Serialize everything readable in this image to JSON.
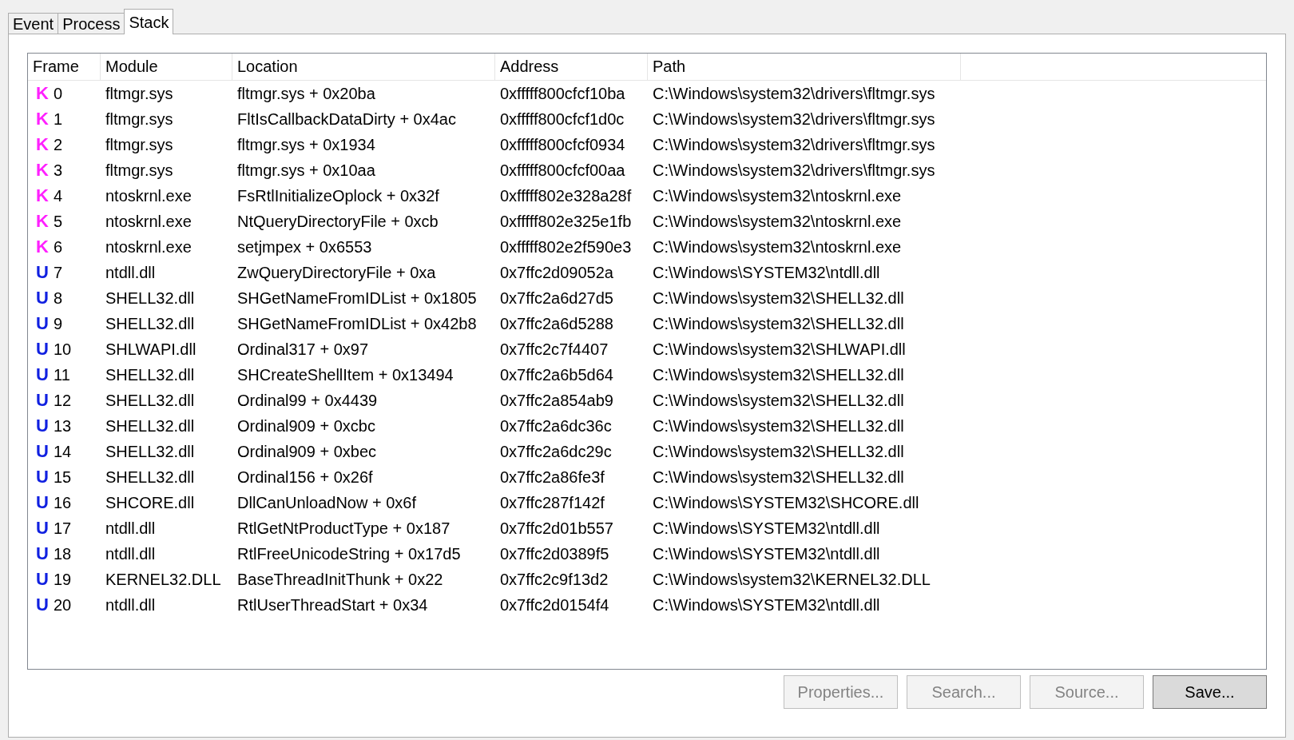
{
  "tabs": [
    {
      "label": "Event",
      "selected": false
    },
    {
      "label": "Process",
      "selected": false
    },
    {
      "label": "Stack",
      "selected": true
    }
  ],
  "table": {
    "columns": [
      "Frame",
      "Module",
      "Location",
      "Address",
      "Path"
    ],
    "rows": [
      {
        "kind": "kernel",
        "mark": "K",
        "frame": "0",
        "module": "fltmgr.sys",
        "location": "fltmgr.sys + 0x20ba",
        "address": "0xfffff800cfcf10ba",
        "path": "C:\\Windows\\system32\\drivers\\fltmgr.sys"
      },
      {
        "kind": "kernel",
        "mark": "K",
        "frame": "1",
        "module": "fltmgr.sys",
        "location": "FltIsCallbackDataDirty + 0x4ac",
        "address": "0xfffff800cfcf1d0c",
        "path": "C:\\Windows\\system32\\drivers\\fltmgr.sys"
      },
      {
        "kind": "kernel",
        "mark": "K",
        "frame": "2",
        "module": "fltmgr.sys",
        "location": "fltmgr.sys + 0x1934",
        "address": "0xfffff800cfcf0934",
        "path": "C:\\Windows\\system32\\drivers\\fltmgr.sys"
      },
      {
        "kind": "kernel",
        "mark": "K",
        "frame": "3",
        "module": "fltmgr.sys",
        "location": "fltmgr.sys + 0x10aa",
        "address": "0xfffff800cfcf00aa",
        "path": "C:\\Windows\\system32\\drivers\\fltmgr.sys"
      },
      {
        "kind": "kernel",
        "mark": "K",
        "frame": "4",
        "module": "ntoskrnl.exe",
        "location": "FsRtlInitializeOplock + 0x32f",
        "address": "0xfffff802e328a28f",
        "path": "C:\\Windows\\system32\\ntoskrnl.exe"
      },
      {
        "kind": "kernel",
        "mark": "K",
        "frame": "5",
        "module": "ntoskrnl.exe",
        "location": "NtQueryDirectoryFile + 0xcb",
        "address": "0xfffff802e325e1fb",
        "path": "C:\\Windows\\system32\\ntoskrnl.exe"
      },
      {
        "kind": "kernel",
        "mark": "K",
        "frame": "6",
        "module": "ntoskrnl.exe",
        "location": "setjmpex + 0x6553",
        "address": "0xfffff802e2f590e3",
        "path": "C:\\Windows\\system32\\ntoskrnl.exe"
      },
      {
        "kind": "user",
        "mark": "U",
        "frame": "7",
        "module": "ntdll.dll",
        "location": "ZwQueryDirectoryFile + 0xa",
        "address": "0x7ffc2d09052a",
        "path": "C:\\Windows\\SYSTEM32\\ntdll.dll"
      },
      {
        "kind": "user",
        "mark": "U",
        "frame": "8",
        "module": "SHELL32.dll",
        "location": "SHGetNameFromIDList + 0x1805",
        "address": "0x7ffc2a6d27d5",
        "path": "C:\\Windows\\system32\\SHELL32.dll"
      },
      {
        "kind": "user",
        "mark": "U",
        "frame": "9",
        "module": "SHELL32.dll",
        "location": "SHGetNameFromIDList + 0x42b8",
        "address": "0x7ffc2a6d5288",
        "path": "C:\\Windows\\system32\\SHELL32.dll"
      },
      {
        "kind": "user",
        "mark": "U",
        "frame": "10",
        "module": "SHLWAPI.dll",
        "location": "Ordinal317 + 0x97",
        "address": "0x7ffc2c7f4407",
        "path": "C:\\Windows\\system32\\SHLWAPI.dll"
      },
      {
        "kind": "user",
        "mark": "U",
        "frame": "11",
        "module": "SHELL32.dll",
        "location": "SHCreateShellItem + 0x13494",
        "address": "0x7ffc2a6b5d64",
        "path": "C:\\Windows\\system32\\SHELL32.dll"
      },
      {
        "kind": "user",
        "mark": "U",
        "frame": "12",
        "module": "SHELL32.dll",
        "location": "Ordinal99 + 0x4439",
        "address": "0x7ffc2a854ab9",
        "path": "C:\\Windows\\system32\\SHELL32.dll"
      },
      {
        "kind": "user",
        "mark": "U",
        "frame": "13",
        "module": "SHELL32.dll",
        "location": "Ordinal909 + 0xcbc",
        "address": "0x7ffc2a6dc36c",
        "path": "C:\\Windows\\system32\\SHELL32.dll"
      },
      {
        "kind": "user",
        "mark": "U",
        "frame": "14",
        "module": "SHELL32.dll",
        "location": "Ordinal909 + 0xbec",
        "address": "0x7ffc2a6dc29c",
        "path": "C:\\Windows\\system32\\SHELL32.dll"
      },
      {
        "kind": "user",
        "mark": "U",
        "frame": "15",
        "module": "SHELL32.dll",
        "location": "Ordinal156 + 0x26f",
        "address": "0x7ffc2a86fe3f",
        "path": "C:\\Windows\\system32\\SHELL32.dll"
      },
      {
        "kind": "user",
        "mark": "U",
        "frame": "16",
        "module": "SHCORE.dll",
        "location": "DllCanUnloadNow + 0x6f",
        "address": "0x7ffc287f142f",
        "path": "C:\\Windows\\SYSTEM32\\SHCORE.dll"
      },
      {
        "kind": "user",
        "mark": "U",
        "frame": "17",
        "module": "ntdll.dll",
        "location": "RtlGetNtProductType + 0x187",
        "address": "0x7ffc2d01b557",
        "path": "C:\\Windows\\SYSTEM32\\ntdll.dll"
      },
      {
        "kind": "user",
        "mark": "U",
        "frame": "18",
        "module": "ntdll.dll",
        "location": "RtlFreeUnicodeString + 0x17d5",
        "address": "0x7ffc2d0389f5",
        "path": "C:\\Windows\\SYSTEM32\\ntdll.dll"
      },
      {
        "kind": "user",
        "mark": "U",
        "frame": "19",
        "module": "KERNEL32.DLL",
        "location": "BaseThreadInitThunk + 0x22",
        "address": "0x7ffc2c9f13d2",
        "path": "C:\\Windows\\system32\\KERNEL32.DLL"
      },
      {
        "kind": "user",
        "mark": "U",
        "frame": "20",
        "module": "ntdll.dll",
        "location": "RtlUserThreadStart + 0x34",
        "address": "0x7ffc2d0154f4",
        "path": "C:\\Windows\\SYSTEM32\\ntdll.dll"
      }
    ]
  },
  "buttons": [
    {
      "label": "Properties...",
      "disabled": true
    },
    {
      "label": "Search...",
      "disabled": true
    },
    {
      "label": "Source...",
      "disabled": true
    },
    {
      "label": "Save...",
      "disabled": false
    }
  ]
}
